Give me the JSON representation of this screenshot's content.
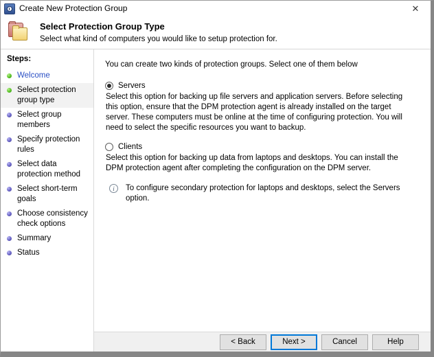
{
  "window": {
    "title": "Create New Protection Group",
    "icon": "dpm-clock-icon",
    "close_label": "✕"
  },
  "header": {
    "title": "Select Protection Group Type",
    "subtitle": "Select what kind of computers you would like to setup protection for.",
    "icon": "folders-icon"
  },
  "sidebar": {
    "label": "Steps:",
    "items": [
      {
        "label": "Welcome",
        "state": "done",
        "link": true
      },
      {
        "label": "Select protection group type",
        "state": "done",
        "link": false
      },
      {
        "label": "Select group members",
        "state": "todo",
        "link": false
      },
      {
        "label": "Specify protection rules",
        "state": "todo",
        "link": false
      },
      {
        "label": "Select data protection method",
        "state": "todo",
        "link": false
      },
      {
        "label": "Select short-term goals",
        "state": "todo",
        "link": false
      },
      {
        "label": "Choose consistency check options",
        "state": "todo",
        "link": false
      },
      {
        "label": "Summary",
        "state": "todo",
        "link": false
      },
      {
        "label": "Status",
        "state": "todo",
        "link": false
      }
    ]
  },
  "main": {
    "intro": "You can create two kinds of protection groups. Select one of them below",
    "options": [
      {
        "label": "Servers",
        "selected": true,
        "description": "Select this option for backing up file servers and application servers. Before selecting this option, ensure that the DPM protection agent is already installed on the target server. These computers must be online at the time of configuring protection. You will need to select the specific resources you want to backup."
      },
      {
        "label": "Clients",
        "selected": false,
        "description": "Select this option for backing up data from laptops and desktops. You can install the DPM protection agent after completing the configuration on the DPM server."
      }
    ],
    "note": {
      "icon": "info-icon",
      "text": "To configure secondary protection for laptops and desktops, select the Servers option."
    }
  },
  "footer": {
    "back": "< Back",
    "next": "Next >",
    "cancel": "Cancel",
    "help": "Help"
  },
  "colors": {
    "accent": "#0078d7",
    "step_done": "#59c228",
    "step_todo": "#6b66c6",
    "link": "#2a4fc4"
  }
}
